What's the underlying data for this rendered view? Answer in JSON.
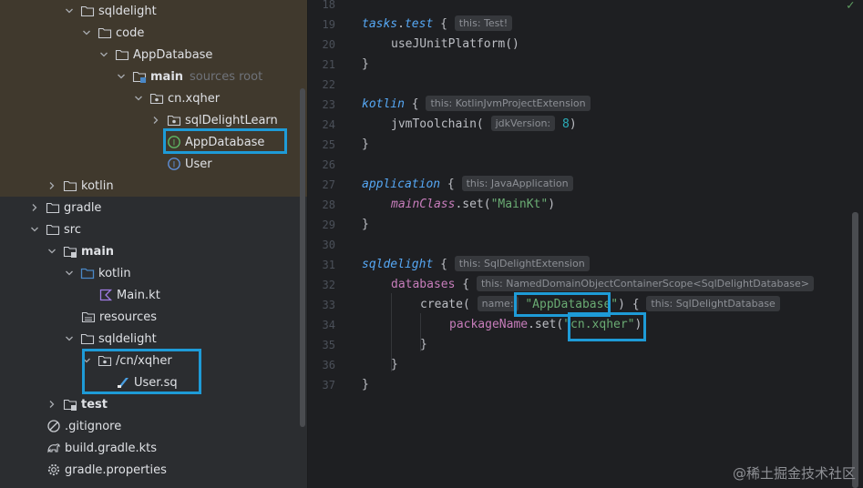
{
  "project_tree": {
    "nodes": [
      {
        "label": "sqldelight",
        "hint": "",
        "icon": "folder-icon",
        "expanded": true
      },
      {
        "label": "code",
        "hint": "",
        "icon": "folder-icon",
        "expanded": true
      },
      {
        "label": "AppDatabase",
        "hint": "",
        "icon": "folder-icon",
        "expanded": true
      },
      {
        "label": "main",
        "hint": "sources root",
        "icon": "source-root-folder-icon",
        "expanded": true
      },
      {
        "label": "cn.xqher",
        "hint": "",
        "icon": "package-icon",
        "expanded": true
      },
      {
        "label": "sqlDelightLearn",
        "hint": "",
        "icon": "package-icon",
        "expanded": false
      },
      {
        "label": "AppDatabase",
        "hint": "",
        "icon": "kotlin-interface-icon",
        "expanded": null
      },
      {
        "label": "User",
        "hint": "",
        "icon": "kotlin-interface-icon",
        "expanded": null
      },
      {
        "label": "kotlin",
        "hint": "",
        "icon": "folder-icon",
        "expanded": false
      },
      {
        "label": "gradle",
        "hint": "",
        "icon": "folder-icon",
        "expanded": false
      },
      {
        "label": "src",
        "hint": "",
        "icon": "folder-icon",
        "expanded": true
      },
      {
        "label": "main",
        "hint": "",
        "icon": "module-folder-icon",
        "expanded": true
      },
      {
        "label": "kotlin",
        "hint": "",
        "icon": "source-folder-icon",
        "expanded": true
      },
      {
        "label": "Main.kt",
        "hint": "",
        "icon": "kotlin-file-icon",
        "expanded": null
      },
      {
        "label": "resources",
        "hint": "",
        "icon": "resources-folder-icon",
        "expanded": null
      },
      {
        "label": "sqldelight",
        "hint": "",
        "icon": "folder-icon",
        "expanded": true
      },
      {
        "label": "/cn/xqher",
        "hint": "",
        "icon": "package-icon",
        "expanded": true
      },
      {
        "label": "User.sq",
        "hint": "",
        "icon": "sq-file-icon",
        "expanded": null
      },
      {
        "label": "test",
        "hint": "",
        "icon": "module-folder-icon",
        "expanded": false
      },
      {
        "label": ".gitignore",
        "hint": "",
        "icon": "gitignore-icon",
        "expanded": null
      },
      {
        "label": "build.gradle.kts",
        "hint": "",
        "icon": "gradle-file-icon",
        "expanded": null
      },
      {
        "label": "gradle.properties",
        "hint": "",
        "icon": "gear-icon",
        "expanded": null
      }
    ]
  },
  "editor": {
    "line_numbers": [
      "18",
      "19",
      "20",
      "21",
      "22",
      "23",
      "24",
      "25",
      "26",
      "27",
      "28",
      "29",
      "30",
      "31",
      "32",
      "33",
      "34",
      "35",
      "36",
      "37"
    ],
    "code": {
      "tasks_test": {
        "kw1": "tasks",
        "kw2": "test",
        "hint": "this: Test!"
      },
      "use_junit": "useJUnitPlatform()",
      "close_brace": "}",
      "kotlin": {
        "kw": "kotlin",
        "hint": "this: KotlinJvmProjectExtension"
      },
      "jvm_toolchain": {
        "fn": "jvmToolchain(",
        "hint": "jdkVersion:",
        "value": "8"
      },
      "application": {
        "kw": "application",
        "hint": "this: JavaApplication"
      },
      "main_class": {
        "prop": "mainClass",
        "call": ".set(",
        "value": "\"MainKt\""
      },
      "sqldelight": {
        "kw": "sqldelight",
        "hint": "this: SqlDelightExtension"
      },
      "databases": {
        "prop": "databases",
        "hint": "this: NamedDomainObjectContainerScope<SqlDelightDatabase>"
      },
      "create": {
        "fn": "create(",
        "param_hint": "name:",
        "value": "\"AppDatabase\"",
        "hint": "this: SqlDelightDatabase"
      },
      "package_name": {
        "prop": "packageName",
        "call": ".set(",
        "value": "\"cn.xqher\""
      }
    }
  },
  "watermark": "@稀土掘金技术社区",
  "colors": {
    "tree_bg": "#2b2d30",
    "editor_bg": "#1e1f22",
    "highlight_box": "#1e9bd7",
    "generated_row": "#40392d"
  }
}
